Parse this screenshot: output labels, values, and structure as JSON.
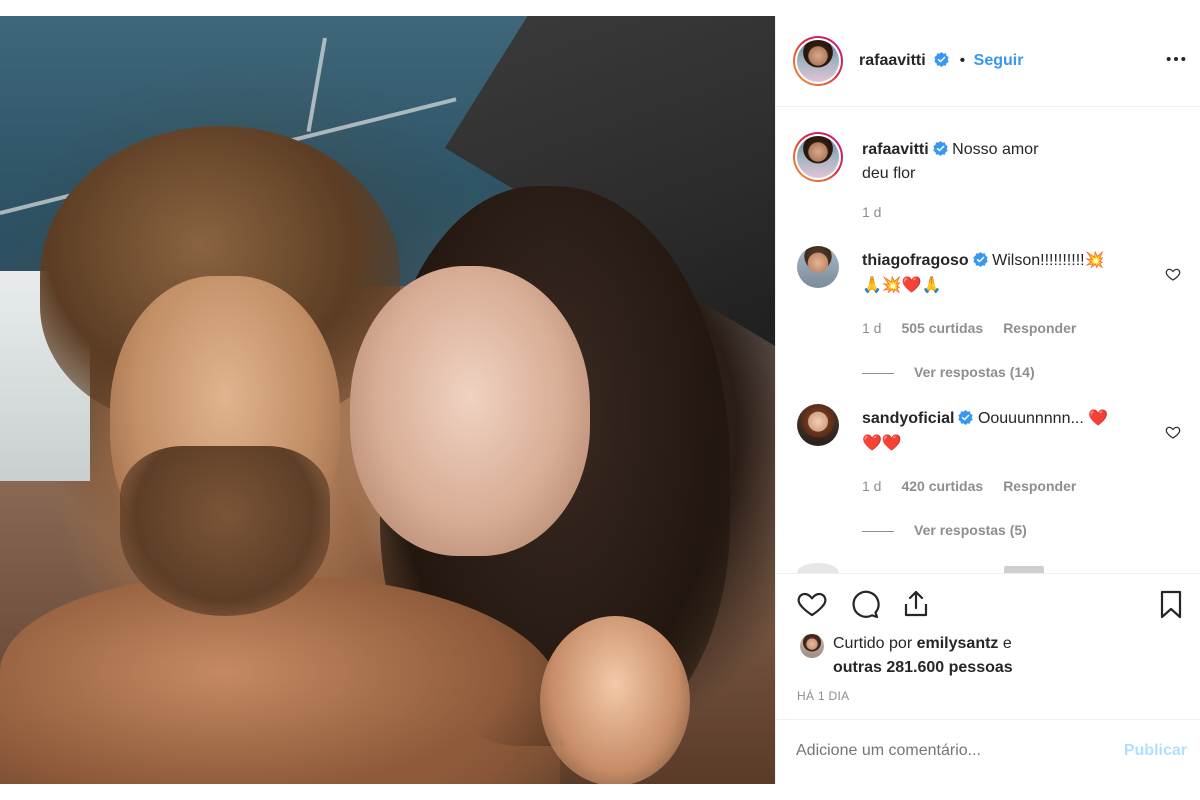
{
  "post": {
    "username": "rafaavitti",
    "follow_label": "Seguir",
    "separator": "•",
    "caption_line1": "Nosso amor",
    "caption_line2": "deu flor",
    "caption_time": "1 d"
  },
  "comments": [
    {
      "username": "thiagofragoso",
      "text": "Wilson!!!!!!!!!!",
      "emoji_line1": "💥",
      "emoji_line2": "🙏💥❤️🙏",
      "time": "1 d",
      "likes": "505 curtidas",
      "reply_label": "Responder",
      "view_replies": "Ver respostas (14)"
    },
    {
      "username": "sandyoficial",
      "text": "Oouuunnnnn...",
      "emoji_line1": "❤️",
      "emoji_line2": "❤️❤️",
      "time": "1 d",
      "likes": "420 curtidas",
      "reply_label": "Responder",
      "view_replies": "Ver respostas (5)"
    }
  ],
  "likes_summary": {
    "prefix": "Curtido por",
    "user": "emilysantz",
    "connector": "e",
    "others": "outras 281.600 pessoas"
  },
  "time_ago": "HÁ 1 DIA",
  "comment_input": {
    "placeholder": "Adicione um comentário...",
    "publish_label": "Publicar"
  },
  "colors": {
    "link_blue": "#3897f0",
    "verified_blue": "#3897f0",
    "publish_disabled": "#b2dffc",
    "muted": "#8e8e8e"
  },
  "icons": {
    "more": "more-options-icon",
    "like": "heart-icon",
    "comment": "comment-icon",
    "share": "share-icon",
    "save": "bookmark-icon"
  }
}
